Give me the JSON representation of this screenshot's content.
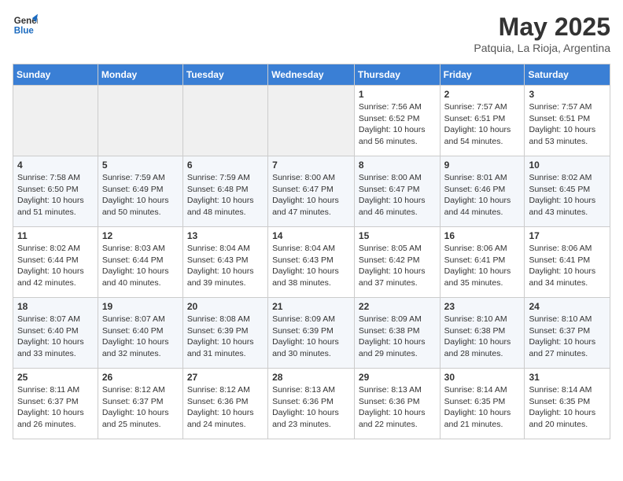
{
  "logo": {
    "line1": "General",
    "line2": "Blue"
  },
  "title": "May 2025",
  "subtitle": "Patquia, La Rioja, Argentina",
  "days_of_week": [
    "Sunday",
    "Monday",
    "Tuesday",
    "Wednesday",
    "Thursday",
    "Friday",
    "Saturday"
  ],
  "weeks": [
    [
      {
        "day": "",
        "info": ""
      },
      {
        "day": "",
        "info": ""
      },
      {
        "day": "",
        "info": ""
      },
      {
        "day": "",
        "info": ""
      },
      {
        "day": "1",
        "info": "Sunrise: 7:56 AM\nSunset: 6:52 PM\nDaylight: 10 hours\nand 56 minutes."
      },
      {
        "day": "2",
        "info": "Sunrise: 7:57 AM\nSunset: 6:51 PM\nDaylight: 10 hours\nand 54 minutes."
      },
      {
        "day": "3",
        "info": "Sunrise: 7:57 AM\nSunset: 6:51 PM\nDaylight: 10 hours\nand 53 minutes."
      }
    ],
    [
      {
        "day": "4",
        "info": "Sunrise: 7:58 AM\nSunset: 6:50 PM\nDaylight: 10 hours\nand 51 minutes."
      },
      {
        "day": "5",
        "info": "Sunrise: 7:59 AM\nSunset: 6:49 PM\nDaylight: 10 hours\nand 50 minutes."
      },
      {
        "day": "6",
        "info": "Sunrise: 7:59 AM\nSunset: 6:48 PM\nDaylight: 10 hours\nand 48 minutes."
      },
      {
        "day": "7",
        "info": "Sunrise: 8:00 AM\nSunset: 6:47 PM\nDaylight: 10 hours\nand 47 minutes."
      },
      {
        "day": "8",
        "info": "Sunrise: 8:00 AM\nSunset: 6:47 PM\nDaylight: 10 hours\nand 46 minutes."
      },
      {
        "day": "9",
        "info": "Sunrise: 8:01 AM\nSunset: 6:46 PM\nDaylight: 10 hours\nand 44 minutes."
      },
      {
        "day": "10",
        "info": "Sunrise: 8:02 AM\nSunset: 6:45 PM\nDaylight: 10 hours\nand 43 minutes."
      }
    ],
    [
      {
        "day": "11",
        "info": "Sunrise: 8:02 AM\nSunset: 6:44 PM\nDaylight: 10 hours\nand 42 minutes."
      },
      {
        "day": "12",
        "info": "Sunrise: 8:03 AM\nSunset: 6:44 PM\nDaylight: 10 hours\nand 40 minutes."
      },
      {
        "day": "13",
        "info": "Sunrise: 8:04 AM\nSunset: 6:43 PM\nDaylight: 10 hours\nand 39 minutes."
      },
      {
        "day": "14",
        "info": "Sunrise: 8:04 AM\nSunset: 6:43 PM\nDaylight: 10 hours\nand 38 minutes."
      },
      {
        "day": "15",
        "info": "Sunrise: 8:05 AM\nSunset: 6:42 PM\nDaylight: 10 hours\nand 37 minutes."
      },
      {
        "day": "16",
        "info": "Sunrise: 8:06 AM\nSunset: 6:41 PM\nDaylight: 10 hours\nand 35 minutes."
      },
      {
        "day": "17",
        "info": "Sunrise: 8:06 AM\nSunset: 6:41 PM\nDaylight: 10 hours\nand 34 minutes."
      }
    ],
    [
      {
        "day": "18",
        "info": "Sunrise: 8:07 AM\nSunset: 6:40 PM\nDaylight: 10 hours\nand 33 minutes."
      },
      {
        "day": "19",
        "info": "Sunrise: 8:07 AM\nSunset: 6:40 PM\nDaylight: 10 hours\nand 32 minutes."
      },
      {
        "day": "20",
        "info": "Sunrise: 8:08 AM\nSunset: 6:39 PM\nDaylight: 10 hours\nand 31 minutes."
      },
      {
        "day": "21",
        "info": "Sunrise: 8:09 AM\nSunset: 6:39 PM\nDaylight: 10 hours\nand 30 minutes."
      },
      {
        "day": "22",
        "info": "Sunrise: 8:09 AM\nSunset: 6:38 PM\nDaylight: 10 hours\nand 29 minutes."
      },
      {
        "day": "23",
        "info": "Sunrise: 8:10 AM\nSunset: 6:38 PM\nDaylight: 10 hours\nand 28 minutes."
      },
      {
        "day": "24",
        "info": "Sunrise: 8:10 AM\nSunset: 6:37 PM\nDaylight: 10 hours\nand 27 minutes."
      }
    ],
    [
      {
        "day": "25",
        "info": "Sunrise: 8:11 AM\nSunset: 6:37 PM\nDaylight: 10 hours\nand 26 minutes."
      },
      {
        "day": "26",
        "info": "Sunrise: 8:12 AM\nSunset: 6:37 PM\nDaylight: 10 hours\nand 25 minutes."
      },
      {
        "day": "27",
        "info": "Sunrise: 8:12 AM\nSunset: 6:36 PM\nDaylight: 10 hours\nand 24 minutes."
      },
      {
        "day": "28",
        "info": "Sunrise: 8:13 AM\nSunset: 6:36 PM\nDaylight: 10 hours\nand 23 minutes."
      },
      {
        "day": "29",
        "info": "Sunrise: 8:13 AM\nSunset: 6:36 PM\nDaylight: 10 hours\nand 22 minutes."
      },
      {
        "day": "30",
        "info": "Sunrise: 8:14 AM\nSunset: 6:35 PM\nDaylight: 10 hours\nand 21 minutes."
      },
      {
        "day": "31",
        "info": "Sunrise: 8:14 AM\nSunset: 6:35 PM\nDaylight: 10 hours\nand 20 minutes."
      }
    ]
  ]
}
